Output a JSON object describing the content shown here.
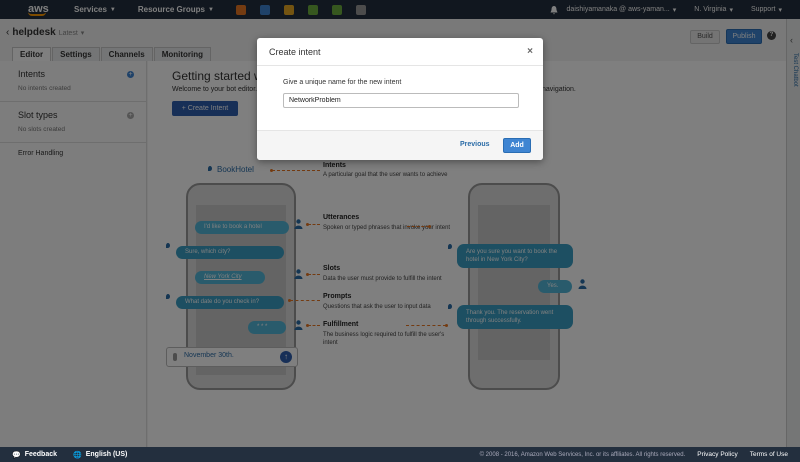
{
  "topnav": {
    "logo": "aws",
    "services": "Services",
    "resource_groups": "Resource Groups",
    "account": "daishiyamanaka @ aws-yaman...",
    "region": "N. Virginia",
    "support": "Support",
    "service_icon_colors": [
      "#e87722",
      "#3f85d2",
      "#e8a922",
      "#6cae3e",
      "#6cae3e",
      "#999999"
    ]
  },
  "header": {
    "bot_name": "helpdesk",
    "version": "Latest",
    "build": "Build",
    "publish": "Publish",
    "help": "?"
  },
  "tabs": [
    "Editor",
    "Settings",
    "Channels",
    "Monitoring"
  ],
  "right_rail": {
    "label": "Test Chatbot"
  },
  "sidebar": {
    "intents_title": "Intents",
    "intents_empty": "No intents created",
    "slots_title": "Slot types",
    "slots_empty": "No slots created",
    "error_handling": "Error Handling"
  },
  "main": {
    "title": "Getting started with yo",
    "desc": "Welcome to your bot editor. Y",
    "desc_tail": "navigation.",
    "create_button": "Create Intent"
  },
  "illustration": {
    "intent_tag": "BookHotel",
    "left_bubbles": [
      "I'd like to book a hotel",
      "Sure, which city?",
      "New York City",
      "What date do you check in?",
      "* * *"
    ],
    "input_text": "November 30th.",
    "right_bubbles": [
      "Are you sure you want to book the hotel in New York City?",
      "Yes.",
      "Thank you. The reservation went through successfully."
    ],
    "annotations": [
      {
        "title": "Intents",
        "desc": "A particular goal that the user wants to achieve"
      },
      {
        "title": "Utterances",
        "desc": "Spoken or typed phrases that invoke your intent"
      },
      {
        "title": "Slots",
        "desc": "Data the user must provide to fulfill the intent"
      },
      {
        "title": "Prompts",
        "desc": "Questions that ask the user to input data"
      },
      {
        "title": "Fulfillment",
        "desc": "The business logic required to fulfill the user's intent"
      }
    ]
  },
  "modal": {
    "title": "Create intent",
    "close": "×",
    "label": "Give a unique name for the new intent",
    "input_value": "NetworkProblem",
    "previous": "Previous",
    "add": "Add"
  },
  "footer": {
    "feedback": "Feedback",
    "language": "English (US)",
    "copyright": "© 2008 - 2016, Amazon Web Services, Inc. or its affiliates. All rights reserved.",
    "privacy": "Privacy Policy",
    "terms": "Terms of Use"
  }
}
